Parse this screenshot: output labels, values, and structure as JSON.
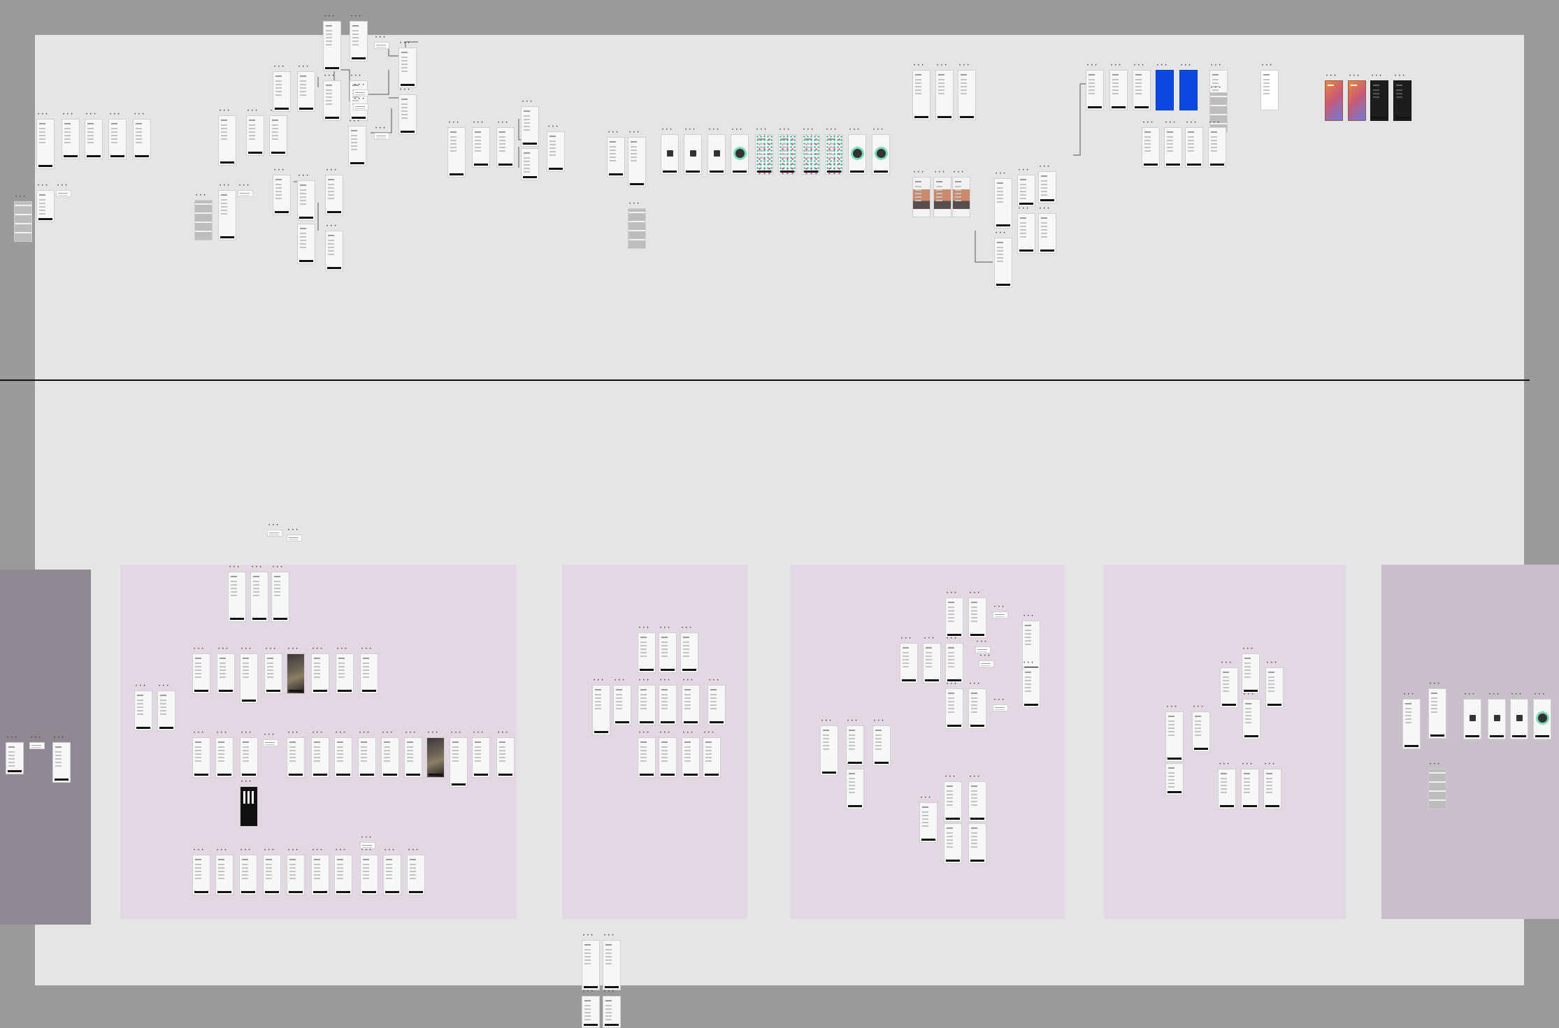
{
  "canvas": {
    "background_color": "#e5e5e5",
    "outer_color": "#9a9a9a",
    "section_color": "#e2d7e2",
    "divider_color": "#111111"
  },
  "frame_label": "• • •"
}
